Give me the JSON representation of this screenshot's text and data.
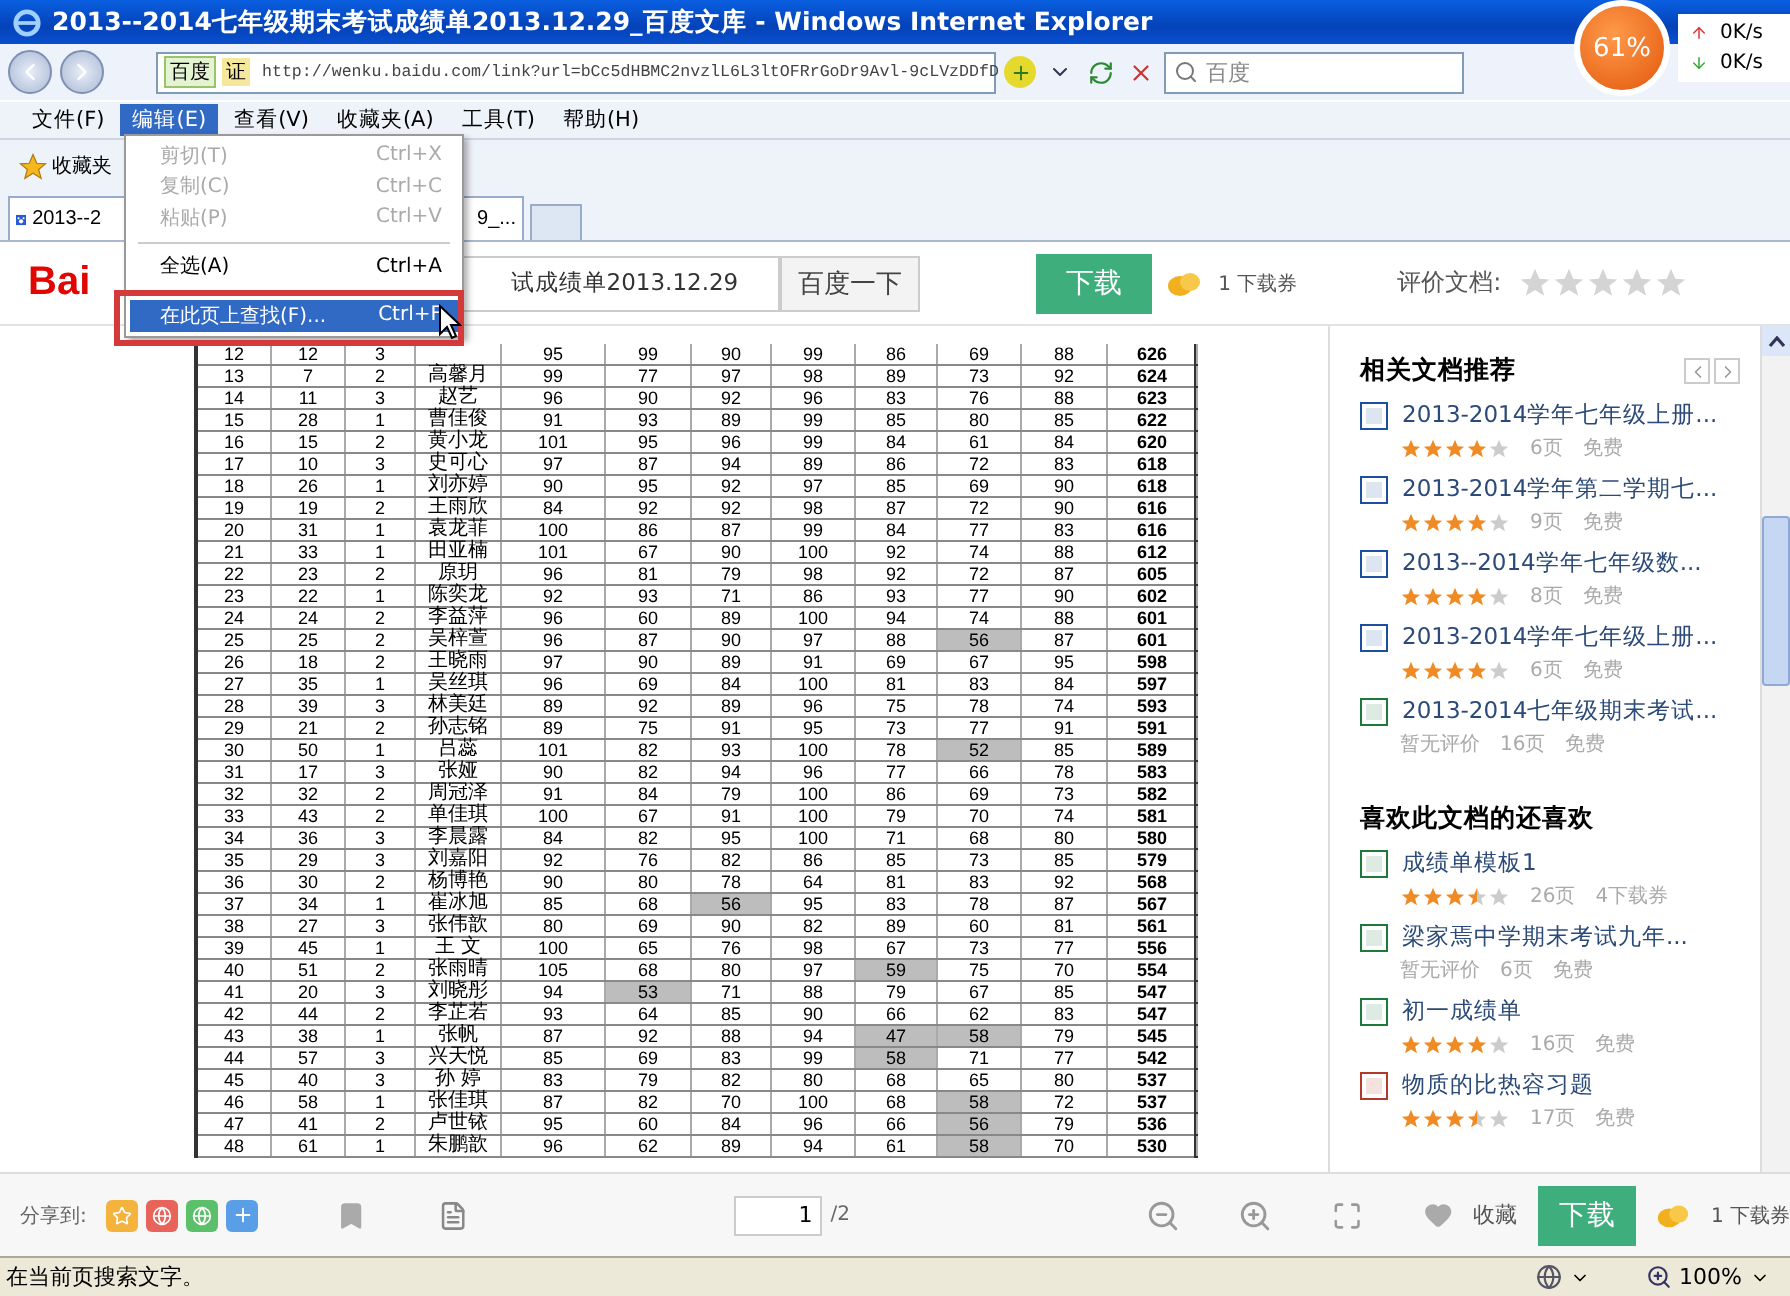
{
  "window": {
    "title": "2013--2014七年级期末考试成绩单2013.12.29_百度文库 - Windows Internet Explorer"
  },
  "widget": {
    "percent": "61%",
    "up": "0K/s",
    "down": "0K/s"
  },
  "address": {
    "site_badge": "百度",
    "cert": "证",
    "url": "http://wenku.baidu.com/link?url=bCc5dHBMC2nvzlL6L3ltOFRrGoDr9Avl-9cLVzDDfD",
    "search_placeholder": "百度"
  },
  "menu_bar": [
    {
      "label": "文件(F)",
      "selected": false
    },
    {
      "label": "编辑(E)",
      "selected": true
    },
    {
      "label": "查看(V)",
      "selected": false
    },
    {
      "label": "收藏夹(A)",
      "selected": false
    },
    {
      "label": "工具(T)",
      "selected": false
    },
    {
      "label": "帮助(H)",
      "selected": false
    }
  ],
  "edit_menu": [
    {
      "kind": "item",
      "label": "剪切(T)",
      "shortcut": "Ctrl+X",
      "disabled": true,
      "selected": false
    },
    {
      "kind": "item",
      "label": "复制(C)",
      "shortcut": "Ctrl+C",
      "disabled": true,
      "selected": false
    },
    {
      "kind": "item",
      "label": "粘贴(P)",
      "shortcut": "Ctrl+V",
      "disabled": true,
      "selected": false
    },
    {
      "kind": "separator"
    },
    {
      "kind": "item",
      "label": "全选(A)",
      "shortcut": "Ctrl+A",
      "disabled": false,
      "selected": false
    },
    {
      "kind": "separator"
    },
    {
      "kind": "item",
      "label": "在此页上查找(F)...",
      "shortcut": "Ctrl+F",
      "disabled": false,
      "selected": true
    }
  ],
  "favorites_bar": {
    "label": "收藏夹"
  },
  "tab": {
    "label_start": "2013--2",
    "label_end": "9_..."
  },
  "header": {
    "logo": "Bai",
    "search_value": "试成绩单2013.12.29",
    "search_button": "百度一下",
    "download_button": "下载",
    "coupon": "1 下载券",
    "rate_label": "评价文档:",
    "stars": 0
  },
  "table": {
    "rows": [
      {
        "no": "12",
        "id": "12",
        "class": "3",
        "scores": [
          "95",
          "99",
          "90",
          "99",
          "86",
          "69",
          "88"
        ],
        "low": [
          false,
          false,
          false,
          false,
          false,
          false,
          false
        ],
        "total": "626"
      },
      {
        "no": "13",
        "id": "7",
        "class": "2",
        "name": "高馨月",
        "scores": [
          "99",
          "77",
          "97",
          "98",
          "89",
          "73",
          "92"
        ],
        "low": [
          false,
          false,
          false,
          false,
          false,
          false,
          false
        ],
        "total": "624"
      },
      {
        "no": "14",
        "id": "11",
        "class": "3",
        "name": "赵艺",
        "scores": [
          "96",
          "90",
          "92",
          "96",
          "83",
          "76",
          "88"
        ],
        "low": [
          false,
          false,
          false,
          false,
          false,
          false,
          false
        ],
        "total": "623"
      },
      {
        "no": "15",
        "id": "28",
        "class": "1",
        "name": "曹佳俊",
        "scores": [
          "91",
          "93",
          "89",
          "99",
          "85",
          "80",
          "85"
        ],
        "low": [
          false,
          false,
          false,
          false,
          false,
          false,
          false
        ],
        "total": "622"
      },
      {
        "no": "16",
        "id": "15",
        "class": "2",
        "name": "黄小龙",
        "scores": [
          "101",
          "95",
          "96",
          "99",
          "84",
          "61",
          "84"
        ],
        "low": [
          false,
          false,
          false,
          false,
          false,
          false,
          false
        ],
        "total": "620"
      },
      {
        "no": "17",
        "id": "10",
        "class": "3",
        "name": "史可心",
        "scores": [
          "97",
          "87",
          "94",
          "89",
          "86",
          "72",
          "83"
        ],
        "low": [
          false,
          false,
          false,
          false,
          false,
          false,
          false
        ],
        "total": "618"
      },
      {
        "no": "18",
        "id": "26",
        "class": "1",
        "name": "刘亦婷",
        "scores": [
          "90",
          "95",
          "92",
          "97",
          "85",
          "69",
          "90"
        ],
        "low": [
          false,
          false,
          false,
          false,
          false,
          false,
          false
        ],
        "total": "618"
      },
      {
        "no": "19",
        "id": "19",
        "class": "2",
        "name": "王雨欣",
        "scores": [
          "84",
          "92",
          "92",
          "98",
          "87",
          "72",
          "90"
        ],
        "low": [
          false,
          false,
          false,
          false,
          false,
          false,
          false
        ],
        "total": "616"
      },
      {
        "no": "20",
        "id": "31",
        "class": "1",
        "name": "袁龙菲",
        "scores": [
          "100",
          "86",
          "87",
          "99",
          "84",
          "77",
          "83"
        ],
        "low": [
          false,
          false,
          false,
          false,
          false,
          false,
          false
        ],
        "total": "616"
      },
      {
        "no": "21",
        "id": "33",
        "class": "1",
        "name": "田亚楠",
        "scores": [
          "101",
          "67",
          "90",
          "100",
          "92",
          "74",
          "88"
        ],
        "low": [
          false,
          false,
          false,
          false,
          false,
          false,
          false
        ],
        "total": "612"
      },
      {
        "no": "22",
        "id": "23",
        "class": "2",
        "name": "原玥",
        "scores": [
          "96",
          "81",
          "79",
          "98",
          "92",
          "72",
          "87"
        ],
        "low": [
          false,
          false,
          false,
          false,
          false,
          false,
          false
        ],
        "total": "605"
      },
      {
        "no": "23",
        "id": "22",
        "class": "1",
        "name": "陈奕龙",
        "scores": [
          "92",
          "93",
          "71",
          "86",
          "93",
          "77",
          "90"
        ],
        "low": [
          false,
          false,
          false,
          false,
          false,
          false,
          false
        ],
        "total": "602"
      },
      {
        "no": "24",
        "id": "24",
        "class": "2",
        "name": "李益萍",
        "scores": [
          "96",
          "60",
          "89",
          "100",
          "94",
          "74",
          "88"
        ],
        "low": [
          false,
          false,
          false,
          false,
          false,
          false,
          false
        ],
        "total": "601"
      },
      {
        "no": "25",
        "id": "25",
        "class": "2",
        "name": "吴梓萱",
        "scores": [
          "96",
          "87",
          "90",
          "97",
          "88",
          "56",
          "87"
        ],
        "low": [
          false,
          false,
          false,
          false,
          false,
          true,
          false
        ],
        "total": "601"
      },
      {
        "no": "26",
        "id": "18",
        "class": "2",
        "name": "王晓雨",
        "scores": [
          "97",
          "90",
          "89",
          "91",
          "69",
          "67",
          "95"
        ],
        "low": [
          false,
          false,
          false,
          false,
          false,
          false,
          false
        ],
        "total": "598"
      },
      {
        "no": "27",
        "id": "35",
        "class": "1",
        "name": "吴丝琪",
        "scores": [
          "96",
          "69",
          "84",
          "100",
          "81",
          "83",
          "84"
        ],
        "low": [
          false,
          false,
          false,
          false,
          false,
          false,
          false
        ],
        "total": "597"
      },
      {
        "no": "28",
        "id": "39",
        "class": "3",
        "name": "林美廷",
        "scores": [
          "89",
          "92",
          "89",
          "96",
          "75",
          "78",
          "74"
        ],
        "low": [
          false,
          false,
          false,
          false,
          false,
          false,
          false
        ],
        "total": "593"
      },
      {
        "no": "29",
        "id": "21",
        "class": "2",
        "name": "孙志铭",
        "scores": [
          "89",
          "75",
          "91",
          "95",
          "73",
          "77",
          "91"
        ],
        "low": [
          false,
          false,
          false,
          false,
          false,
          false,
          false
        ],
        "total": "591"
      },
      {
        "no": "30",
        "id": "50",
        "class": "1",
        "name": "吕蕊",
        "scores": [
          "101",
          "82",
          "93",
          "100",
          "78",
          "52",
          "85"
        ],
        "low": [
          false,
          false,
          false,
          false,
          false,
          true,
          false
        ],
        "total": "589"
      },
      {
        "no": "31",
        "id": "17",
        "class": "3",
        "name": "张娅",
        "scores": [
          "90",
          "82",
          "94",
          "96",
          "77",
          "66",
          "78"
        ],
        "low": [
          false,
          false,
          false,
          false,
          false,
          false,
          false
        ],
        "total": "583"
      },
      {
        "no": "32",
        "id": "32",
        "class": "2",
        "name": "周冠泽",
        "scores": [
          "91",
          "84",
          "79",
          "100",
          "86",
          "69",
          "73"
        ],
        "low": [
          false,
          false,
          false,
          false,
          false,
          false,
          false
        ],
        "total": "582"
      },
      {
        "no": "33",
        "id": "43",
        "class": "2",
        "name": "单佳琪",
        "scores": [
          "100",
          "67",
          "91",
          "100",
          "79",
          "70",
          "74"
        ],
        "low": [
          false,
          false,
          false,
          false,
          false,
          false,
          false
        ],
        "total": "581"
      },
      {
        "no": "34",
        "id": "36",
        "class": "3",
        "name": "李晨露",
        "scores": [
          "84",
          "82",
          "95",
          "100",
          "71",
          "68",
          "80"
        ],
        "low": [
          false,
          false,
          false,
          false,
          false,
          false,
          false
        ],
        "total": "580"
      },
      {
        "no": "35",
        "id": "29",
        "class": "3",
        "name": "刘嘉阳",
        "scores": [
          "92",
          "76",
          "82",
          "86",
          "85",
          "73",
          "85"
        ],
        "low": [
          false,
          false,
          false,
          false,
          false,
          false,
          false
        ],
        "total": "579"
      },
      {
        "no": "36",
        "id": "30",
        "class": "2",
        "name": "杨博艳",
        "scores": [
          "90",
          "80",
          "78",
          "64",
          "81",
          "83",
          "92"
        ],
        "low": [
          false,
          false,
          false,
          false,
          false,
          false,
          false
        ],
        "total": "568"
      },
      {
        "no": "37",
        "id": "34",
        "class": "1",
        "name": "崔冰旭",
        "scores": [
          "85",
          "68",
          "56",
          "95",
          "83",
          "78",
          "87"
        ],
        "low": [
          false,
          false,
          true,
          false,
          false,
          false,
          false
        ],
        "total": "567"
      },
      {
        "no": "38",
        "id": "27",
        "class": "3",
        "name": "张伟歆",
        "scores": [
          "80",
          "69",
          "90",
          "82",
          "89",
          "60",
          "81"
        ],
        "low": [
          false,
          false,
          false,
          false,
          false,
          false,
          false
        ],
        "total": "561"
      },
      {
        "no": "39",
        "id": "45",
        "class": "1",
        "name": "王 文",
        "scores": [
          "100",
          "65",
          "76",
          "98",
          "67",
          "73",
          "77"
        ],
        "low": [
          false,
          false,
          false,
          false,
          false,
          false,
          false
        ],
        "total": "556"
      },
      {
        "no": "40",
        "id": "51",
        "class": "2",
        "name": "张雨晴",
        "scores": [
          "105",
          "68",
          "80",
          "97",
          "59",
          "75",
          "70"
        ],
        "low": [
          false,
          false,
          false,
          false,
          true,
          false,
          false
        ],
        "total": "554"
      },
      {
        "no": "41",
        "id": "20",
        "class": "3",
        "name": "刘晓彤",
        "scores": [
          "94",
          "53",
          "71",
          "88",
          "79",
          "67",
          "85"
        ],
        "low": [
          false,
          true,
          false,
          false,
          false,
          false,
          false
        ],
        "total": "547"
      },
      {
        "no": "42",
        "id": "44",
        "class": "2",
        "name": "李芷若",
        "scores": [
          "93",
          "64",
          "85",
          "90",
          "66",
          "62",
          "83"
        ],
        "low": [
          false,
          false,
          false,
          false,
          false,
          false,
          false
        ],
        "total": "547"
      },
      {
        "no": "43",
        "id": "38",
        "class": "1",
        "name": "张帆",
        "scores": [
          "87",
          "92",
          "88",
          "94",
          "47",
          "58",
          "79"
        ],
        "low": [
          false,
          false,
          false,
          false,
          true,
          true,
          false
        ],
        "total": "545"
      },
      {
        "no": "44",
        "id": "57",
        "class": "3",
        "name": "兴天悦",
        "scores": [
          "85",
          "69",
          "83",
          "99",
          "58",
          "71",
          "77"
        ],
        "low": [
          false,
          false,
          false,
          false,
          true,
          false,
          false
        ],
        "total": "542"
      },
      {
        "no": "45",
        "id": "40",
        "class": "3",
        "name": "孙 婷",
        "scores": [
          "83",
          "79",
          "82",
          "80",
          "68",
          "65",
          "80"
        ],
        "low": [
          false,
          false,
          false,
          false,
          false,
          false,
          false
        ],
        "total": "537"
      },
      {
        "no": "46",
        "id": "58",
        "class": "1",
        "name": "张佳琪",
        "scores": [
          "87",
          "82",
          "70",
          "100",
          "68",
          "58",
          "72"
        ],
        "low": [
          false,
          false,
          false,
          false,
          false,
          true,
          false
        ],
        "total": "537"
      },
      {
        "no": "47",
        "id": "41",
        "class": "2",
        "name": "卢世铱",
        "scores": [
          "95",
          "60",
          "84",
          "96",
          "66",
          "56",
          "79"
        ],
        "low": [
          false,
          false,
          false,
          false,
          false,
          true,
          false
        ],
        "total": "536"
      },
      {
        "no": "48",
        "id": "61",
        "class": "1",
        "name": "朱鹏歆",
        "scores": [
          "96",
          "62",
          "89",
          "94",
          "61",
          "58",
          "70"
        ],
        "low": [
          false,
          false,
          false,
          false,
          false,
          true,
          false
        ],
        "total": "530"
      }
    ]
  },
  "related": {
    "title": "相关文档推荐",
    "items": [
      {
        "kind": "word",
        "title": "2013-2014学年七年级上册...",
        "stars": 4,
        "pages": "6页",
        "price": "免费"
      },
      {
        "kind": "word",
        "title": "2013-2014学年第二学期七...",
        "stars": 4,
        "pages": "9页",
        "price": "免费"
      },
      {
        "kind": "word",
        "title": "2013--2014学年七年级数...",
        "stars": 4,
        "pages": "8页",
        "price": "免费"
      },
      {
        "kind": "word",
        "title": "2013-2014学年七年级上册...",
        "stars": 4,
        "pages": "6页",
        "price": "免费"
      },
      {
        "kind": "excel",
        "title": "2013-2014七年级期末考试...",
        "rating_text": "暂无评价",
        "pages": "16页",
        "price": "免费"
      }
    ]
  },
  "also_liked": {
    "title": "喜欢此文档的还喜欢",
    "items": [
      {
        "kind": "excel",
        "title": "成绩单模板1",
        "stars": 3.5,
        "pages": "26页",
        "price": "4下载券"
      },
      {
        "kind": "excel",
        "title": "梁家焉中学期末考试九年...",
        "rating_text": "暂无评价",
        "pages": "6页",
        "price": "免费"
      },
      {
        "kind": "excel",
        "title": "初一成绩单",
        "stars": 4,
        "pages": "16页",
        "price": "免费"
      },
      {
        "kind": "ppt",
        "title": "物质的比热容习题",
        "stars": 3.5,
        "pages": "17页",
        "price": "免费"
      }
    ]
  },
  "bottom_bar": {
    "share_label": "分享到:",
    "page_value": "1",
    "page_total": "/2",
    "favorite": "收藏",
    "download_button": "下载",
    "coupon": "1 下载券"
  },
  "status_bar": {
    "text": "在当前页搜索文字。",
    "zoom": "100%"
  }
}
